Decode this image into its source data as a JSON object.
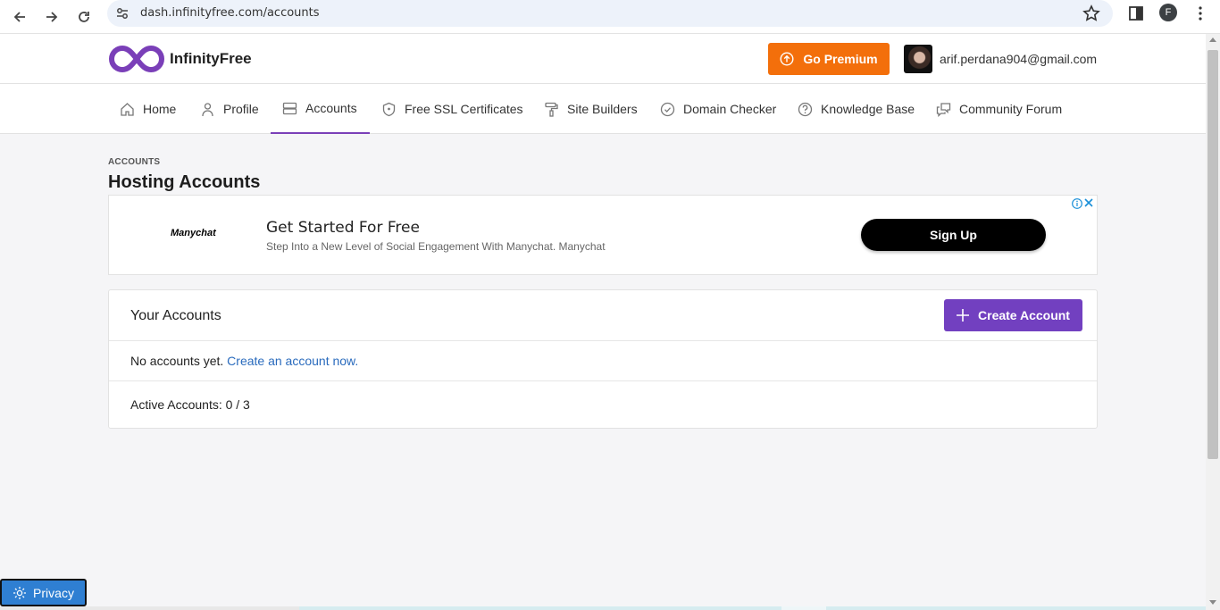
{
  "browser": {
    "url": "dash.infinityfree.com/accounts",
    "profile_initial": "F"
  },
  "header": {
    "brand": "InfinityFree",
    "premium_label": "Go Premium",
    "user_email": "arif.perdana904@gmail.com",
    "accent": "#f36f0b"
  },
  "nav": {
    "items": [
      {
        "label": "Home",
        "icon": "home-icon"
      },
      {
        "label": "Profile",
        "icon": "user-icon"
      },
      {
        "label": "Accounts",
        "icon": "server-icon",
        "active": true
      },
      {
        "label": "Free SSL Certificates",
        "icon": "shield-icon"
      },
      {
        "label": "Site Builders",
        "icon": "paint-roller-icon"
      },
      {
        "label": "Domain Checker",
        "icon": "check-circle-icon"
      },
      {
        "label": "Knowledge Base",
        "icon": "help-circle-icon"
      },
      {
        "label": "Community Forum",
        "icon": "chat-icon"
      }
    ],
    "active_color": "#7a3fb8"
  },
  "page": {
    "breadcrumb": "ACCOUNTS",
    "title": "Hosting Accounts"
  },
  "ad": {
    "logo": "Manychat",
    "headline": "Get Started For Free",
    "subline": "Step Into a New Level of Social Engagement With Manychat. Manychat",
    "button": "Sign Up"
  },
  "accounts_card": {
    "title": "Your Accounts",
    "create_button": "Create Account",
    "empty_text": "No accounts yet.",
    "create_link": "Create an account now.",
    "active_accounts": "Active Accounts: 0 / 3",
    "button_color": "#7240c0"
  },
  "privacy": {
    "label": "Privacy"
  }
}
